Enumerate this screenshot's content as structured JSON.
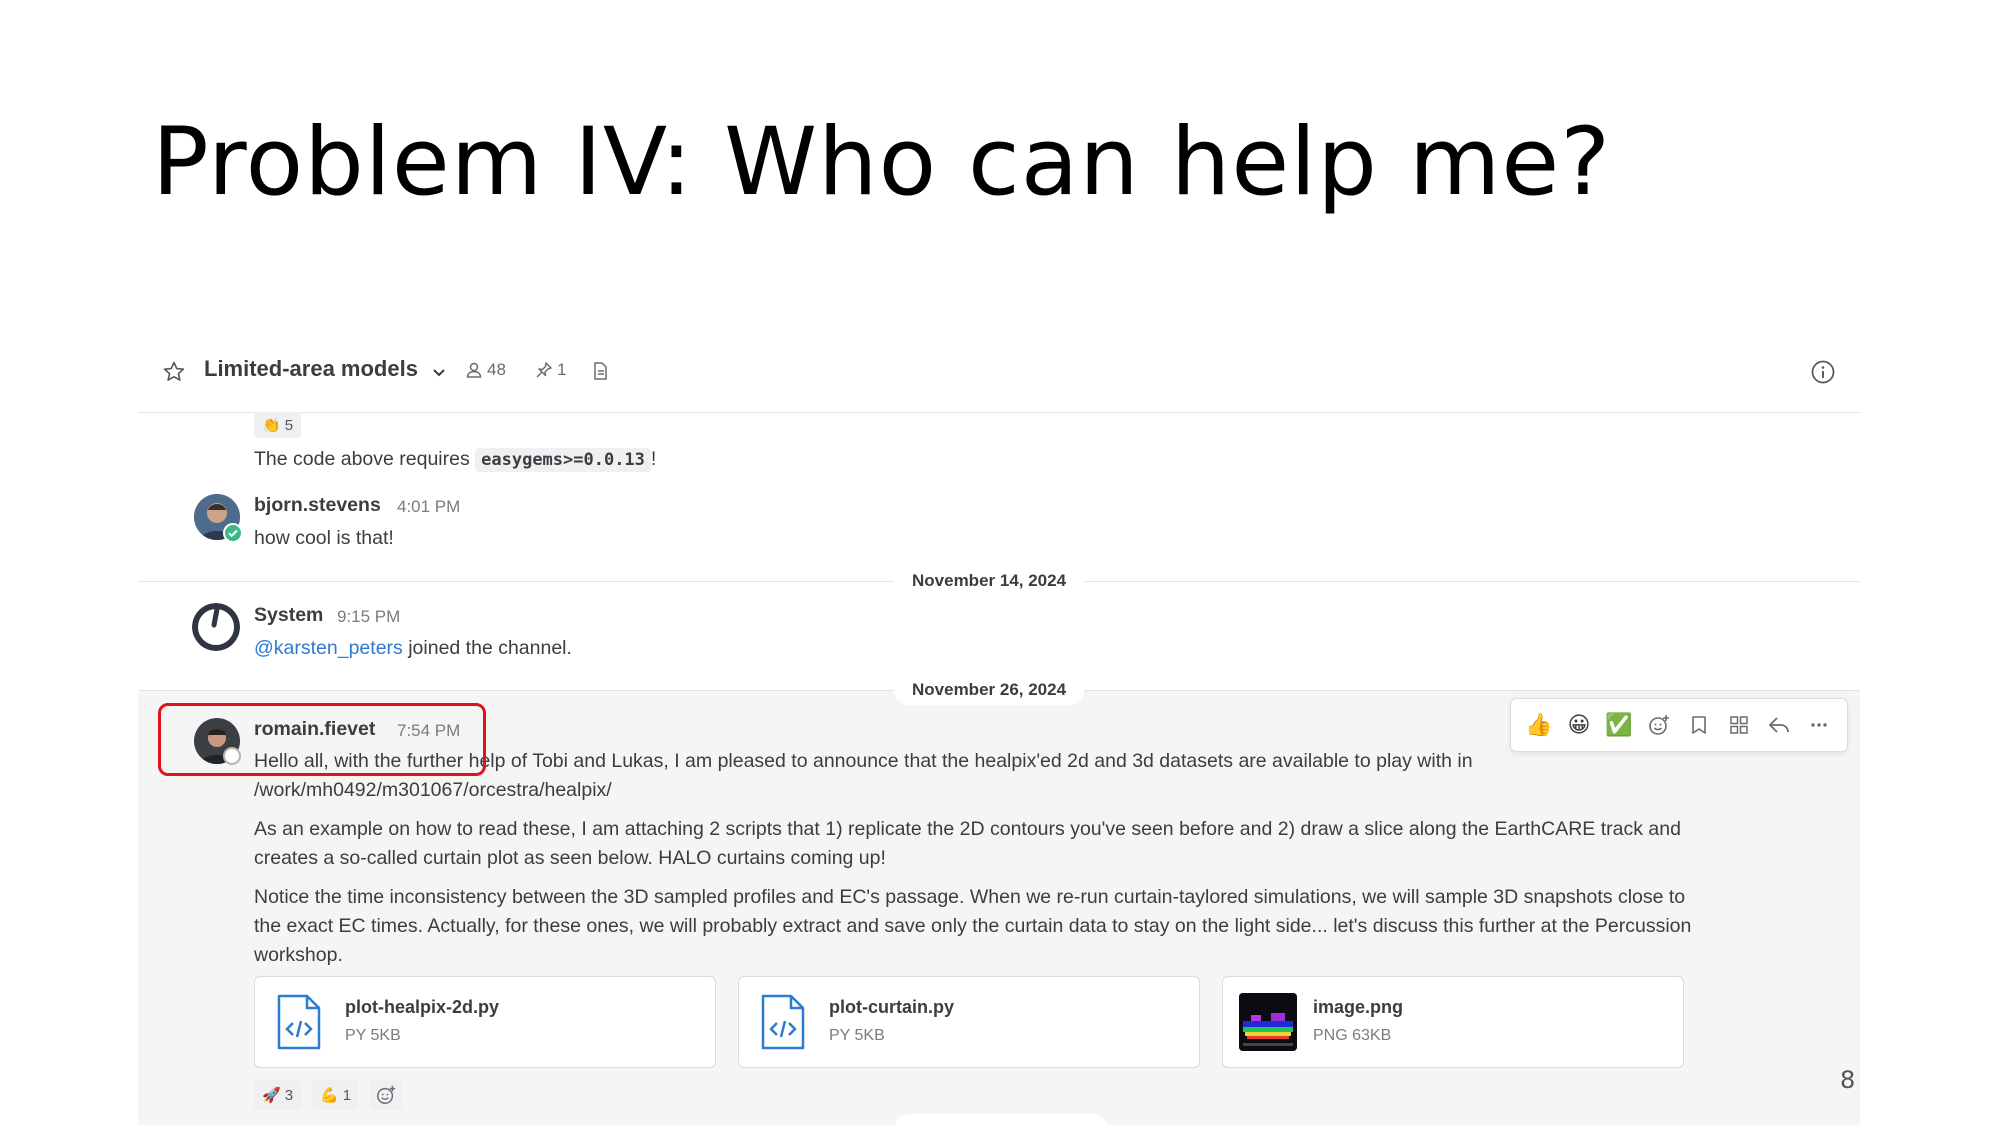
{
  "slide": {
    "title": "Problem IV: Who can help me?",
    "page_number": "8"
  },
  "channel": {
    "name": "Limited-area models",
    "member_count": "48",
    "pinned_count": "1"
  },
  "reactions_top": {
    "emoji": "👏",
    "count": "5"
  },
  "messages": [
    {
      "text_before": "The code above requires ",
      "code": "easygems>=0.0.13",
      "text_after": "!"
    },
    {
      "username": "bjorn.stevens",
      "time": "4:01 PM",
      "text": "how cool is that!"
    },
    {
      "username": "System",
      "time": "9:15 PM",
      "mention": "@karsten_peters",
      "text": " joined the channel."
    },
    {
      "username": "romain.fievet",
      "time": "7:54 PM",
      "para1_line1": "Hello all, with the further help of Tobi and Lukas, I am pleased to announce that the healpix'ed 2d and 3d datasets are available to play with in",
      "para1_line2": "/work/mh0492/m301067/orcestra/healpix/",
      "para2_line1": "As an example on how to read these, I am attaching 2 scripts that 1) replicate the 2D contours you've seen before and 2) draw a slice along the EarthCARE track and",
      "para2_line2": "creates a so-called curtain plot as seen below. HALO curtains coming up!",
      "para3_line1": "Notice the time inconsistency between the 3D sampled profiles and EC's passage. When we re-run curtain-taylored simulations, we will sample 3D snapshots close to",
      "para3_line2": "the exact EC times. Actually, for these ones, we will probably extract and save only the curtain data to stay on the light side... let's discuss this further at the Percussion",
      "para3_line3": "workshop."
    }
  ],
  "date_separators": [
    "November 14, 2024",
    "November 26, 2024"
  ],
  "attachments": [
    {
      "name": "plot-healpix-2d.py",
      "meta": "PY 5KB",
      "icon": "code-file-icon"
    },
    {
      "name": "plot-curtain.py",
      "meta": "PY 5KB",
      "icon": "code-file-icon"
    },
    {
      "name": "image.png",
      "meta": "PNG 63KB",
      "icon": "image-thumbnail"
    }
  ],
  "post_reactions": [
    {
      "emoji": "🚀",
      "count": "3"
    },
    {
      "emoji": "💪",
      "count": "1"
    }
  ],
  "hover_toolbar": {
    "quick_emojis": [
      "👍",
      "😀",
      "✅"
    ]
  },
  "colors": {
    "highlight_box": "#e0121a",
    "mention": "#2e7bd1",
    "online_status": "#3db887"
  }
}
